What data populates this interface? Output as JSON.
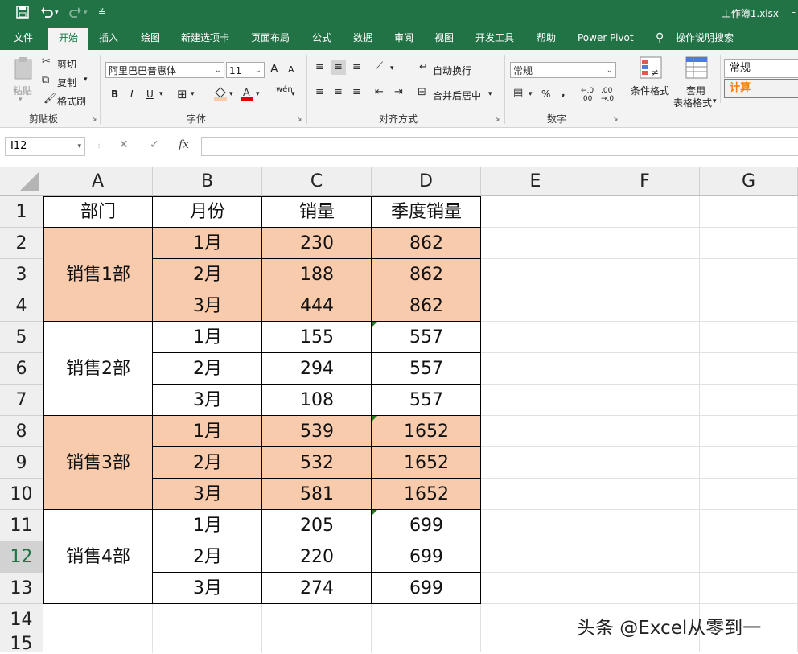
{
  "title_bar": {
    "window_title": "工作簿1.xlsx",
    "right_fragment": "-",
    "quick_access": [
      "save-icon",
      "undo-icon",
      "undo-dropdown-icon",
      "redo-icon",
      "redo-dropdown-icon",
      "customize-icon"
    ]
  },
  "ribbon_tabs": [
    "文件",
    "开始",
    "插入",
    "绘图",
    "新建选项卡",
    "页面布局",
    "公式",
    "数据",
    "审阅",
    "视图",
    "开发工具",
    "帮助",
    "Power Pivot",
    "操作说明搜索"
  ],
  "active_tab": "开始",
  "ribbon": {
    "clipboard": {
      "paste": "粘贴",
      "cut": "剪切",
      "copy": "复制",
      "format_painter": "格式刷",
      "group": "剪贴板"
    },
    "font": {
      "name": "阿里巴巴普惠体",
      "size": "11",
      "bold": "B",
      "italic": "I",
      "underline": "U",
      "wen": "wén",
      "group": "字体",
      "increase": "A",
      "decrease": "A"
    },
    "alignment": {
      "wrap": "自动换行",
      "merge": "合并后居中",
      "group": "对齐方式"
    },
    "number": {
      "format": "常规",
      "percent": "%",
      "comma": ",",
      "inc_dec": "←.0 .00",
      "dec_dec": ".00 →.0",
      "group": "数字"
    },
    "styles": {
      "conditional": "条件格式",
      "table_line1": "套用",
      "table_line2": "表格格式",
      "normal": "常规",
      "calc": "计算"
    }
  },
  "name_box": "I12",
  "formula_icons": {
    "cancel": "✕",
    "enter": "✓",
    "fx": "fx"
  },
  "columns": [
    "A",
    "B",
    "C",
    "D",
    "E",
    "F",
    "G"
  ],
  "rows": [
    "1",
    "2",
    "3",
    "4",
    "5",
    "6",
    "7",
    "8",
    "9",
    "10",
    "11",
    "12",
    "13",
    "14",
    "15"
  ],
  "selected_row": "12",
  "table": {
    "headers": [
      "部门",
      "月份",
      "销量",
      "季度销量"
    ],
    "departments": [
      "销售1部",
      "销售2部",
      "销售3部",
      "销售4部"
    ],
    "data": [
      [
        "1月",
        "230",
        "862"
      ],
      [
        "2月",
        "188",
        "862"
      ],
      [
        "3月",
        "444",
        "862"
      ],
      [
        "1月",
        "155",
        "557"
      ],
      [
        "2月",
        "294",
        "557"
      ],
      [
        "3月",
        "108",
        "557"
      ],
      [
        "1月",
        "539",
        "1652"
      ],
      [
        "2月",
        "532",
        "1652"
      ],
      [
        "3月",
        "581",
        "1652"
      ],
      [
        "1月",
        "205",
        "699"
      ],
      [
        "2月",
        "220",
        "699"
      ],
      [
        "3月",
        "274",
        "699"
      ]
    ]
  },
  "colors": {
    "excel_green": "#217346",
    "highlight": "#f8cbad",
    "error_marker": "#1e7b1e"
  },
  "watermark": "头条 @Excel从零到一"
}
